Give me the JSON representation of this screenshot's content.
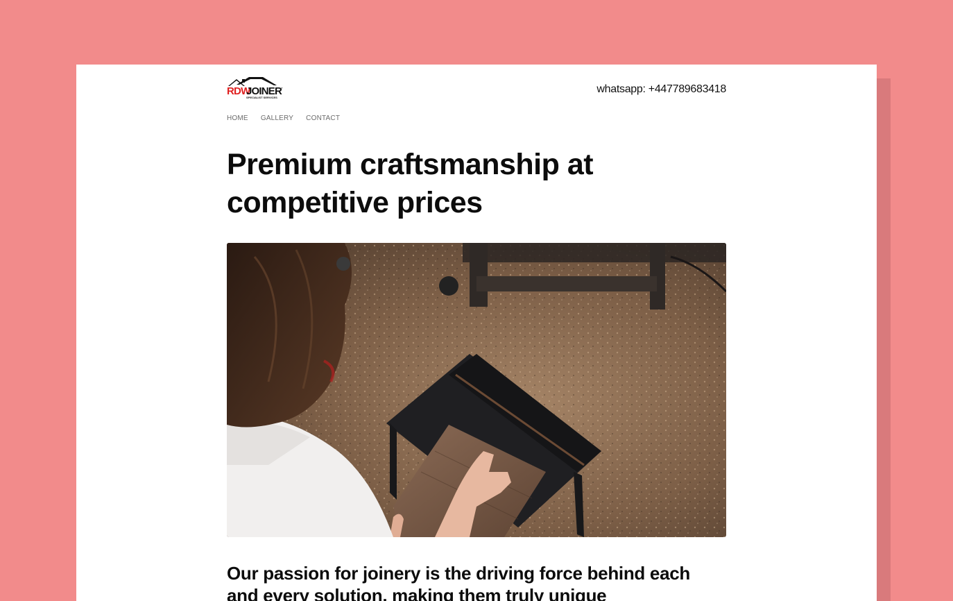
{
  "brand": {
    "logo_text_red": "RDW",
    "logo_text_black": "JOINERY",
    "logo_tagline": "SPECIALIST SERVICES"
  },
  "header": {
    "contact": "whatsapp: +447789683418"
  },
  "nav": {
    "items": [
      "HOME",
      "GALLERY",
      "CONTACT"
    ]
  },
  "hero": {
    "headline": "Premium craftsmanship at competitive prices",
    "image_alt_icon": "woodworking-photo"
  },
  "intro": {
    "subhead": "Our passion for joinery is the driving force behind each and every solution, making them truly unique"
  },
  "colors": {
    "background": "#f28b8b",
    "card": "#ffffff",
    "text": "#0c0c0c",
    "logo_red": "#e02020"
  }
}
